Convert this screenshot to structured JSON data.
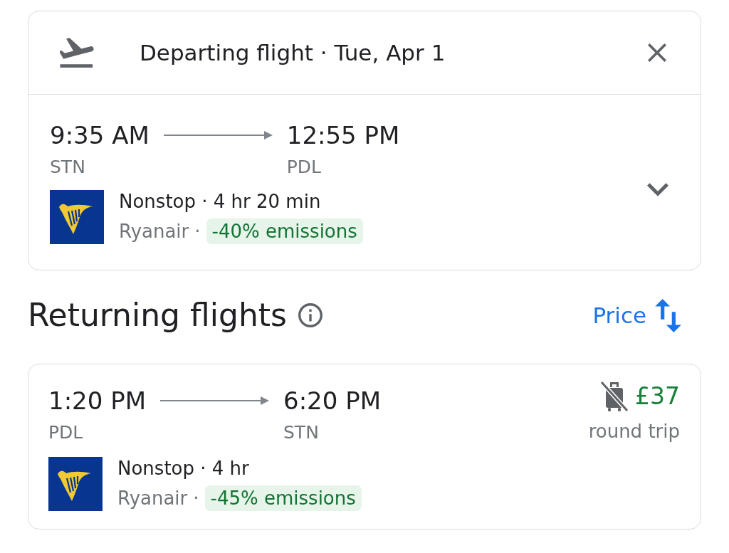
{
  "departing": {
    "title": "Departing flight · Tue, Apr 1",
    "expanded": false,
    "flight": {
      "departure_time": "9:35 AM",
      "arrival_time": "12:55 PM",
      "origin": "STN",
      "destination": "PDL",
      "summary": "Nonstop · 4 hr 20 min",
      "airline": "Ryanair",
      "separator": "·",
      "emissions": "-40% emissions"
    }
  },
  "returning": {
    "title": "Returning flights",
    "sort_label": "Price",
    "flights": [
      {
        "departure_time": "1:20 PM",
        "arrival_time": "6:20 PM",
        "origin": "PDL",
        "destination": "STN",
        "summary": "Nonstop · 4 hr",
        "airline": "Ryanair",
        "separator": "·",
        "emissions": "-45% emissions",
        "carry_on_included": false,
        "price": "£37",
        "price_note": "round trip"
      }
    ]
  }
}
